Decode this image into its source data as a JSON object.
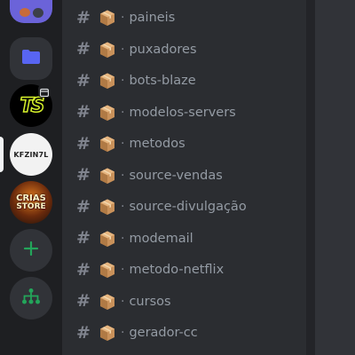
{
  "servers": [
    {
      "id": "top",
      "icon": "server-avatar"
    },
    {
      "id": "folder",
      "icon": "folder-icon"
    },
    {
      "id": "ts",
      "icon": "ts-logo",
      "logo_text": "TS"
    },
    {
      "id": "kf",
      "icon": "kfzin-logo",
      "logo_text": "KFZIN7L"
    },
    {
      "id": "cs",
      "icon": "crias-store-logo",
      "logo_line1": "CRIAS",
      "logo_line2": "STORE"
    },
    {
      "id": "add",
      "icon": "plus-icon"
    },
    {
      "id": "discover",
      "icon": "discover-icon"
    }
  ],
  "colors": {
    "rail_bg": "#1e1f22",
    "channels_bg": "#2b2d31",
    "chat_bg": "#313338",
    "channel_text": "#949ba4",
    "icon_green": "#23a55a",
    "folder_blue": "#5865f2"
  },
  "channel_prefix_separator": "·",
  "channels": [
    {
      "name": "paineis"
    },
    {
      "name": "puxadores"
    },
    {
      "name": "bots-blaze"
    },
    {
      "name": "modelos-servers"
    },
    {
      "name": "metodos"
    },
    {
      "name": "source-vendas"
    },
    {
      "name": "source-divulgação"
    },
    {
      "name": "modemail"
    },
    {
      "name": "metodo-netflix"
    },
    {
      "name": "cursos"
    },
    {
      "name": "gerador-cc"
    }
  ]
}
